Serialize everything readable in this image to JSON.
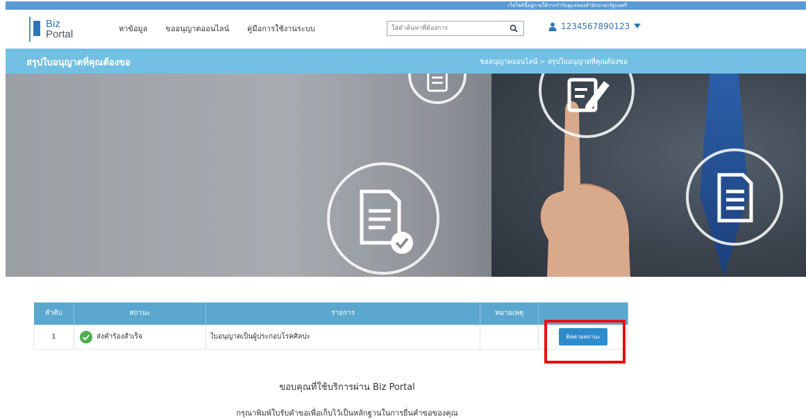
{
  "topbar": {
    "notice": "เว็บไซต์นี้อยู่ภายใต้การกำกับดูแลของสำนักนายกรัฐมนตรี"
  },
  "header": {
    "logo": {
      "line1": "Biz",
      "line2": "Portal"
    },
    "nav": [
      {
        "label": "หาข้อมูล"
      },
      {
        "label": "ขออนุญาตออนไลน์"
      },
      {
        "label": "คู่มือการใช้งานระบบ"
      }
    ],
    "search": {
      "placeholder": "ใส่คำค้นหาที่ต้องการ",
      "value": ""
    },
    "user": {
      "id": "1234567890123"
    }
  },
  "titlebar": {
    "title": "สรุปใบอนุญาตที่คุณต้องขอ",
    "breadcrumb": [
      "ขออนุญาตออนไลน์",
      ">",
      "สรุปใบอนุญาตที่คุณต้องขอ"
    ]
  },
  "table": {
    "headers": [
      "ลำดับ",
      "สถานะ",
      "รายการ",
      "หมายเหตุ",
      ""
    ],
    "rows": [
      {
        "no": "1",
        "status": "ส่งคำร้องสำเร็จ",
        "item": "ใบอนุญาตเป็นผู้ประกอบโรคศิลปะ",
        "note": "",
        "action": "ติดตามสถานะ"
      }
    ]
  },
  "footer": {
    "thanks": "ขอบคุณที่ใช้บริการผ่าน Biz Portal",
    "print_note": "กรุณาพิมพ์ใบรับคำขอเพื่อเก็บไว้เป็นหลักฐานในการยื่นคำขอของคุณ"
  },
  "colors": {
    "accent": "#74c0e4",
    "table_header": "#5ba7cf",
    "button": "#2e8ccc",
    "highlight": "#e8100f",
    "success": "#4cae4c"
  },
  "icons": [
    "search-icon",
    "user-icon",
    "caret-down-icon",
    "check-circle-icon",
    "document-icon",
    "edit-document-icon"
  ]
}
